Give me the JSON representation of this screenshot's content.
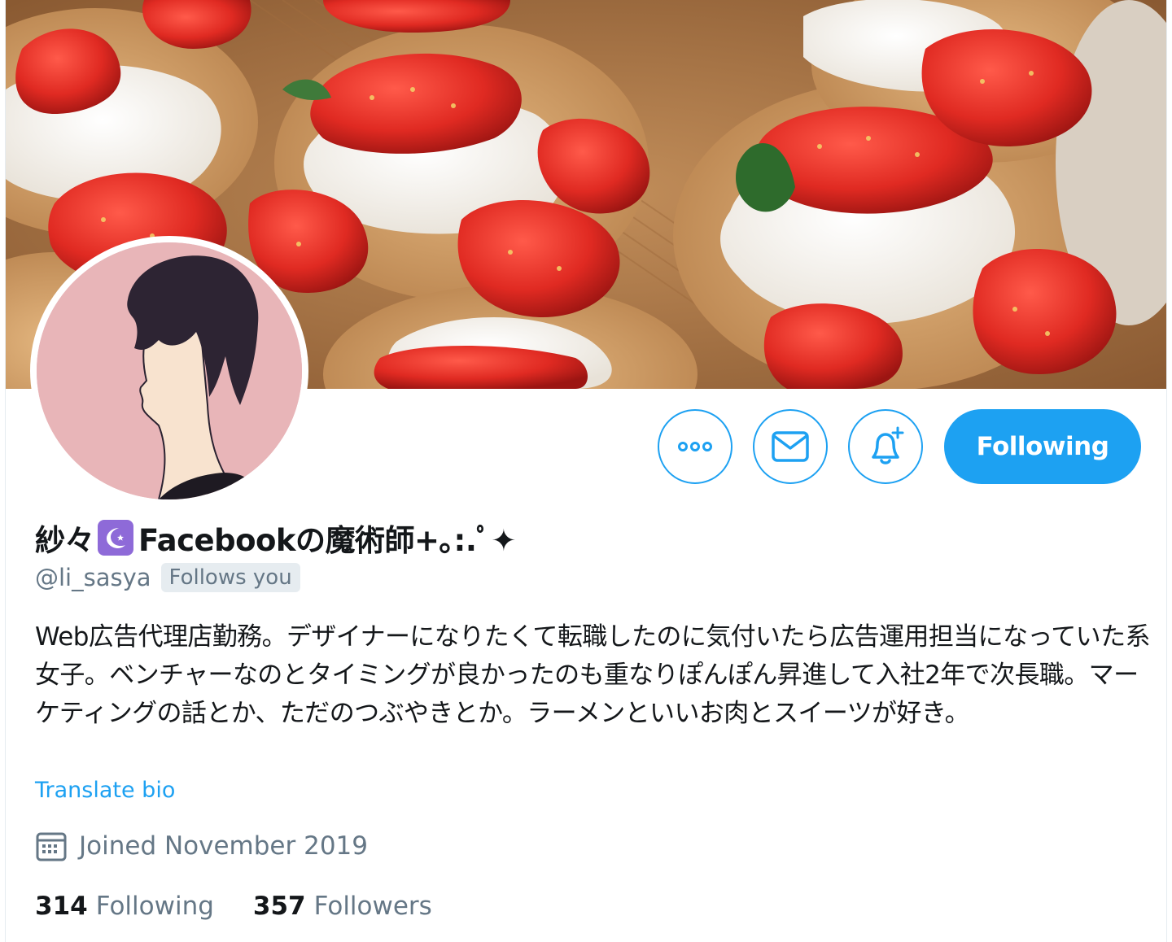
{
  "profile": {
    "display_name": "紗々",
    "display_name_suffix": "Facebookの魔術師+｡:.ﾟ✦",
    "handle": "@li_sasya",
    "follows_you": "Follows you",
    "bio": "Web広告代理店勤務。デザイナーになりたくて転職したのに気付いたら広告運用担当になっていた系女子。ベンチャーなのとタイミングが良かったのも重なりぽんぽん昇進して入社2年で次長職。マーケティングの話とか、ただのつぶやきとか。ラーメンといいお肉とスイーツが好き。",
    "translate_label": "Translate bio",
    "joined": "Joined November 2019",
    "stats": {
      "following_count": "314",
      "following_label": "Following",
      "followers_count": "357",
      "followers_label": "Followers"
    }
  },
  "actions": {
    "more_icon": "more-icon",
    "message_icon": "envelope-icon",
    "notify_icon": "bell-plus-icon",
    "following_label": "Following"
  },
  "colors": {
    "accent": "#1da1f2",
    "text_primary": "#14171a",
    "text_secondary": "#657786",
    "badge_bg": "#e6ecf0",
    "moon_badge": "#8e6ad8",
    "avatar_bg": "#e8b5b8"
  }
}
